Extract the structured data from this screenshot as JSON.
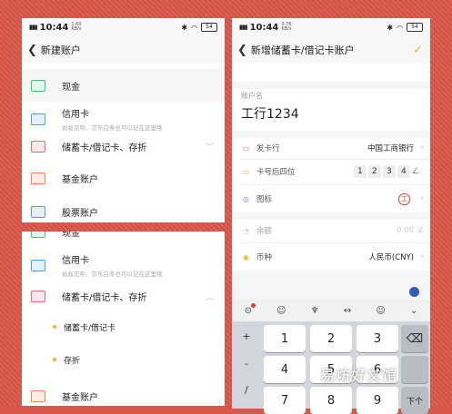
{
  "status_left": {
    "time": "10:44",
    "net": "1.60 KB/s"
  },
  "status_right": {
    "time": "10:44",
    "net": "0.76 KB/s"
  },
  "battery": "54",
  "left_top": {
    "title": "新建账户",
    "items": [
      {
        "label": "现金",
        "icon": "cash-icon"
      },
      {
        "label": "信用卡",
        "sub": "蚂蚁花呗、京东白条也可以记在这里哦",
        "icon": "credit-card-icon"
      },
      {
        "label": "储蓄卡/借记卡、存折",
        "icon": "debit-card-icon"
      },
      {
        "label": "基金账户",
        "icon": "fund-icon"
      },
      {
        "label": "股票账户",
        "icon": "stock-icon"
      }
    ]
  },
  "left_bottom": {
    "items": [
      {
        "label": "现金"
      },
      {
        "label": "信用卡",
        "sub": "蚂蚁花呗、京东白条也可以记在这里哦"
      },
      {
        "label": "储蓄卡/借记卡、存折"
      },
      {
        "label": "储蓄卡/借记卡"
      },
      {
        "label": "存折"
      },
      {
        "label": "基金账户"
      }
    ]
  },
  "right": {
    "title": "新增储蓄卡/借记卡账户",
    "account_name_label": "账户名",
    "account_name_value": "工行1234",
    "rows": {
      "bank_label": "发卡行",
      "bank_value": "中国工商银行",
      "last4_label": "卡号后四位",
      "last4_digits": [
        "1",
        "2",
        "3",
        "4"
      ],
      "icon_label": "图标",
      "balance_label": "余额",
      "balance_value": "0.00",
      "currency_label": "币种",
      "currency_value": "人民币(CNY)"
    }
  },
  "keyboard": {
    "side_keys": [
      "+",
      "-",
      "/"
    ],
    "keys": [
      "1",
      "2",
      "3",
      "4",
      "5",
      "6",
      "7",
      "8",
      "9"
    ],
    "next_label": "下个"
  },
  "watermark": "易坊好文馆"
}
